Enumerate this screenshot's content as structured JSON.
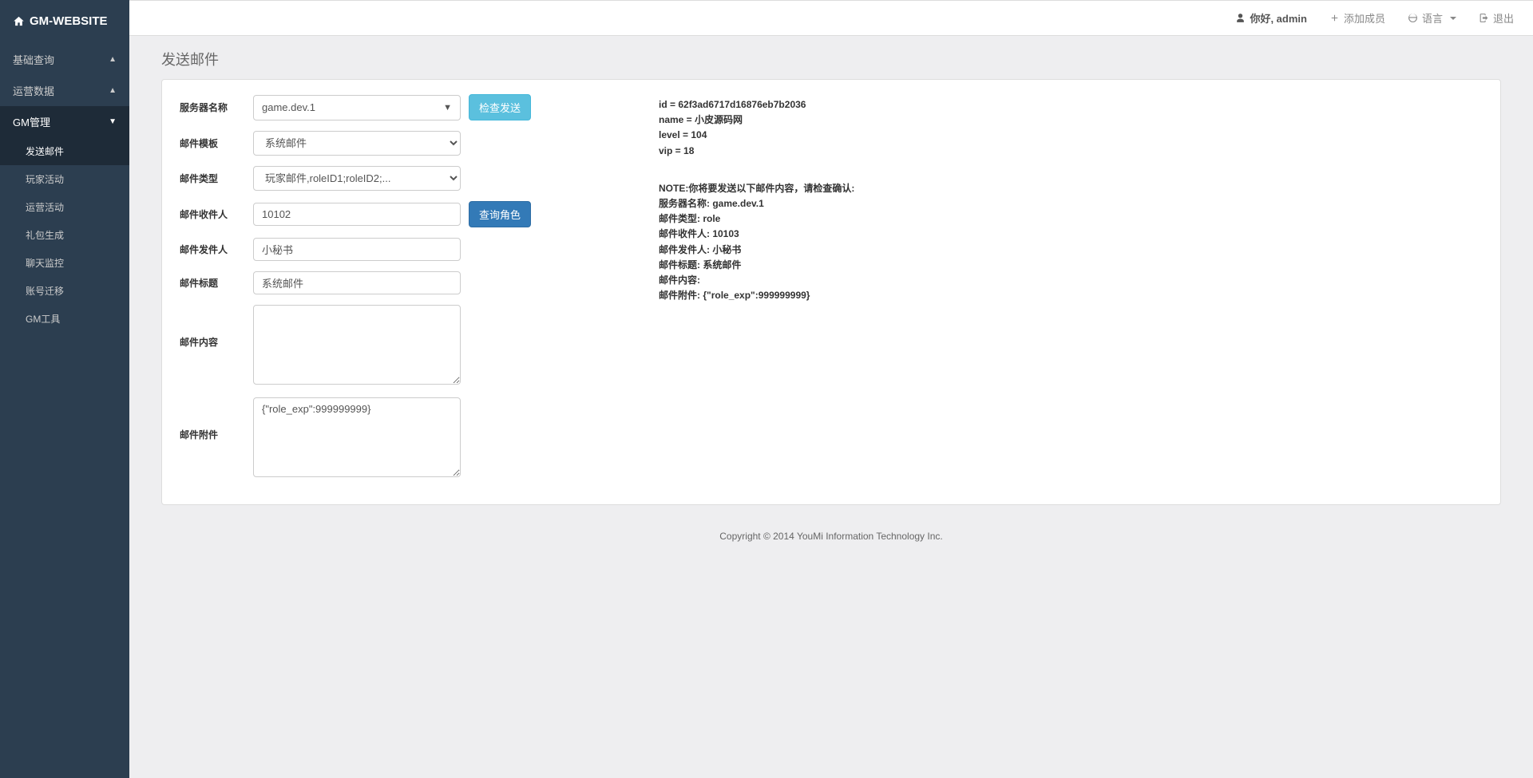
{
  "brand": "GM-WEBSITE",
  "sidebar": {
    "sections": [
      {
        "label": "基础查询",
        "collapsed": true
      },
      {
        "label": "运营数据",
        "collapsed": true
      },
      {
        "label": "GM管理",
        "collapsed": false
      }
    ],
    "gm_items": [
      "发送邮件",
      "玩家活动",
      "运营活动",
      "礼包生成",
      "聊天监控",
      "账号迁移",
      "GM工具"
    ]
  },
  "topbar": {
    "greeting": "你好, admin",
    "add_member": "添加成员",
    "language": "语言",
    "logout": "退出"
  },
  "page": {
    "title": "发送邮件"
  },
  "form": {
    "server_label": "服务器名称",
    "server_value": "game.dev.1",
    "check_send_btn": "检查发送",
    "template_label": "邮件模板",
    "template_value": "系统邮件",
    "type_label": "邮件类型",
    "type_value": "玩家邮件,roleID1;roleID2;...",
    "recipient_label": "邮件收件人",
    "recipient_value": "10102",
    "query_role_btn": "查询角色",
    "sender_label": "邮件发件人",
    "sender_value": "小秘书",
    "title_label": "邮件标题",
    "title_value": "系统邮件",
    "content_label": "邮件内容",
    "content_value": "",
    "attach_label": "邮件附件",
    "attach_value": "{\"role_exp\":999999999}"
  },
  "info": {
    "player": {
      "id_line": "id = 62f3ad6717d16876eb7b2036",
      "name_line": "name = 小皮源码网",
      "level_line": "level = 104",
      "vip_line": "vip = 18"
    },
    "preview": {
      "note": "NOTE:你将要发送以下邮件内容，请检查确认:",
      "server": "服务器名称: game.dev.1",
      "type": "邮件类型: role",
      "recipient": "邮件收件人: 10103",
      "sender": "邮件发件人: 小秘书",
      "title": "邮件标题: 系统邮件",
      "content": "邮件内容:",
      "attach": "邮件附件: {\"role_exp\":999999999}"
    }
  },
  "footer": "Copyright © 2014 YouMi Information Technology Inc."
}
